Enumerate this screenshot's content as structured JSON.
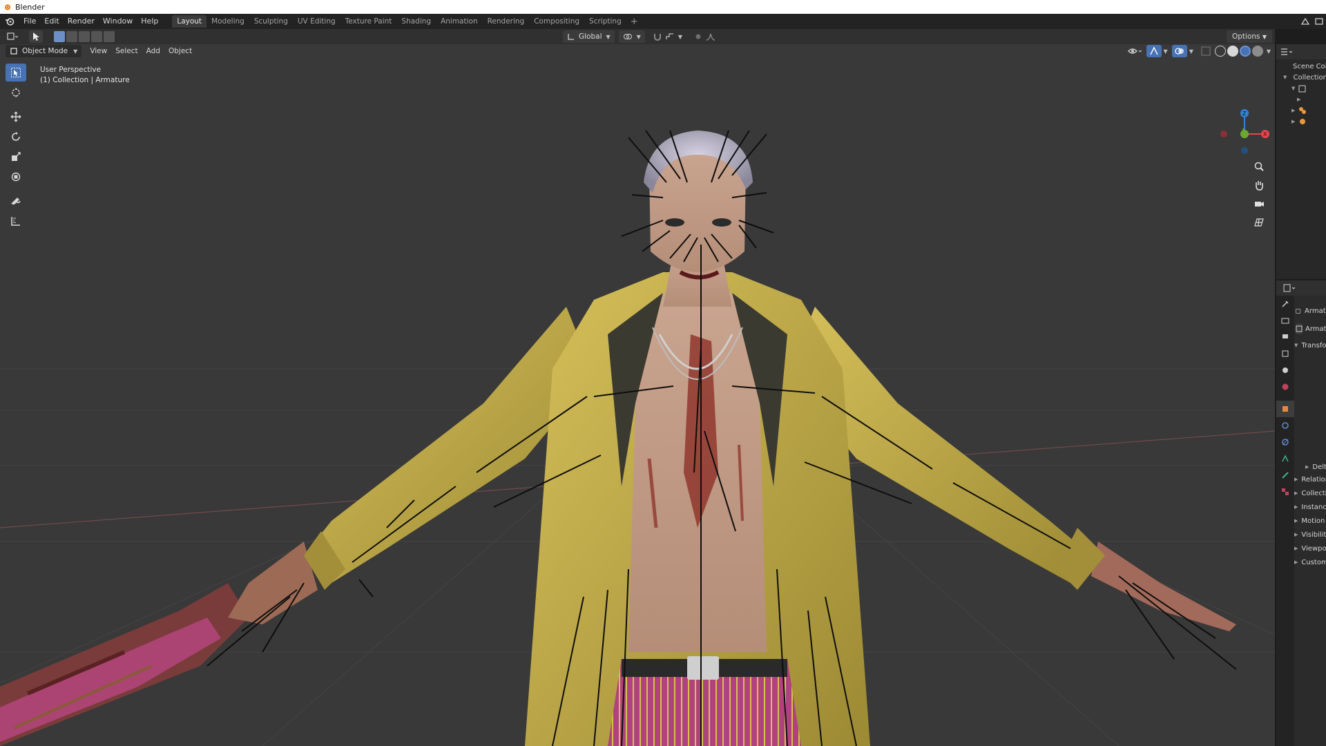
{
  "os_titlebar": {
    "title": "Blender"
  },
  "topbar": {
    "menus": [
      "File",
      "Edit",
      "Render",
      "Window",
      "Help"
    ],
    "workspaces": [
      "Layout",
      "Modeling",
      "Sculpting",
      "UV Editing",
      "Texture Paint",
      "Shading",
      "Animation",
      "Rendering",
      "Compositing",
      "Scripting"
    ],
    "active_workspace": "Layout",
    "add_workspace": "+"
  },
  "toolheader": {
    "transform_orientation": "Global",
    "options_label": "Options"
  },
  "viewport_header": {
    "mode": "Object Mode",
    "menus": [
      "View",
      "Select",
      "Add",
      "Object"
    ]
  },
  "viewport_info": {
    "perspective": "User Perspective",
    "context": "(1) Collection | Armature"
  },
  "tools": [
    "select-box",
    "cursor",
    "move",
    "rotate",
    "scale",
    "transform",
    "annotate",
    "measure"
  ],
  "nav_gizmo": {
    "axes": [
      "X",
      "Y",
      "Z"
    ],
    "colors": {
      "x": "#e8444e",
      "y": "#6da833",
      "z": "#2f82d8"
    }
  },
  "nav_buttons": [
    "zoom",
    "pan",
    "camera",
    "grid"
  ],
  "outliner": {
    "rows": [
      "Scene Collection",
      "Collection",
      "",
      "",
      "",
      ""
    ]
  },
  "properties": {
    "object_name": "Armature",
    "data_name": "Armature",
    "sections": [
      "Transform",
      "Delta Transform",
      "Relations",
      "Collections",
      "Instancing",
      "Motion Paths",
      "Visibility",
      "Viewport Display",
      "Custom Properties"
    ]
  },
  "colors": {
    "accent": "#4772b3",
    "viewport_bg": "#393939",
    "header_bg": "#303030",
    "coat": "#c9b24a",
    "pants": "#b0427f"
  }
}
